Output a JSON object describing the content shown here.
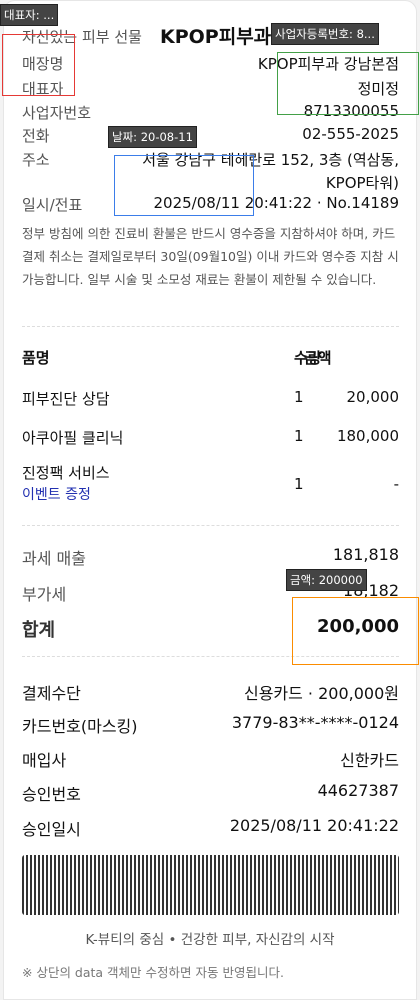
{
  "header": {
    "slogan": "자신있는 피부 선물",
    "brand": "KPOP피부과"
  },
  "store": [
    {
      "label": "매장명",
      "value": "KPOP피부과 강남본점"
    },
    {
      "label": "대표자",
      "value": "정미정"
    },
    {
      "label": "사업자번호",
      "value": "8713300055"
    },
    {
      "label": "전화",
      "value": "02-555-2025"
    },
    {
      "label": "주소",
      "value": "서울 강남구 테헤란로 152, 3층 (역삼동,",
      "value2": "KPOP타워)"
    },
    {
      "label": "일시/전표",
      "value": "2025/08/11 20:41:22 · No.14189"
    }
  ],
  "notice": "정부 방침에 의한 진료비 환불은 반드시 영수증을 지참하셔야 하며, 카드 결제 취소는 결제일로부터 30일(09월10일) 이내 카드와 영수증 지참 시 가능합니다. 일부 시술 및 소모성 재료는 환불이 제한될 수 있습니다.",
  "items_header": {
    "name": "품명",
    "qty": "수량",
    "amount": "금액"
  },
  "items": [
    {
      "name": "피부진단 상담",
      "qty": "1",
      "amount": "20,000"
    },
    {
      "name": "아쿠아필 클리닉",
      "qty": "1",
      "amount": "180,000"
    },
    {
      "name": "진정팩 서비스",
      "sub": "이벤트 증정",
      "qty": "1",
      "amount": "-"
    }
  ],
  "totals": {
    "taxable_label": "과세 매출",
    "taxable": "181,818",
    "vat_label": "부가세",
    "vat": "18,182",
    "total_label": "합계",
    "total": "200,000"
  },
  "payment": [
    {
      "label": "결제수단",
      "value": "신용카드 · 200,000원"
    },
    {
      "label": "카드번호(마스킹)",
      "value": "3779-83**-****-0124"
    },
    {
      "label": "매입사",
      "value": "신한카드"
    },
    {
      "label": "승인번호",
      "value": "44627387"
    },
    {
      "label": "승인일시",
      "value": "2025/08/11 20:41:22"
    }
  ],
  "footer": {
    "slogan": "K-뷰티의 중심 • 건강한 피부, 자신감의 시작",
    "note": "※ 상단의 data 객체만 수정하면 자동 반영됩니다."
  },
  "annotations": [
    {
      "label": "대표자: ...",
      "color": "#e53935"
    },
    {
      "label": "사업자등록번호: 8...",
      "color": "#43a047"
    },
    {
      "label": "날짜: 20-08-11",
      "color": "#3b7de9"
    },
    {
      "label": "금액: 200000",
      "color": "#fb8c00"
    }
  ]
}
